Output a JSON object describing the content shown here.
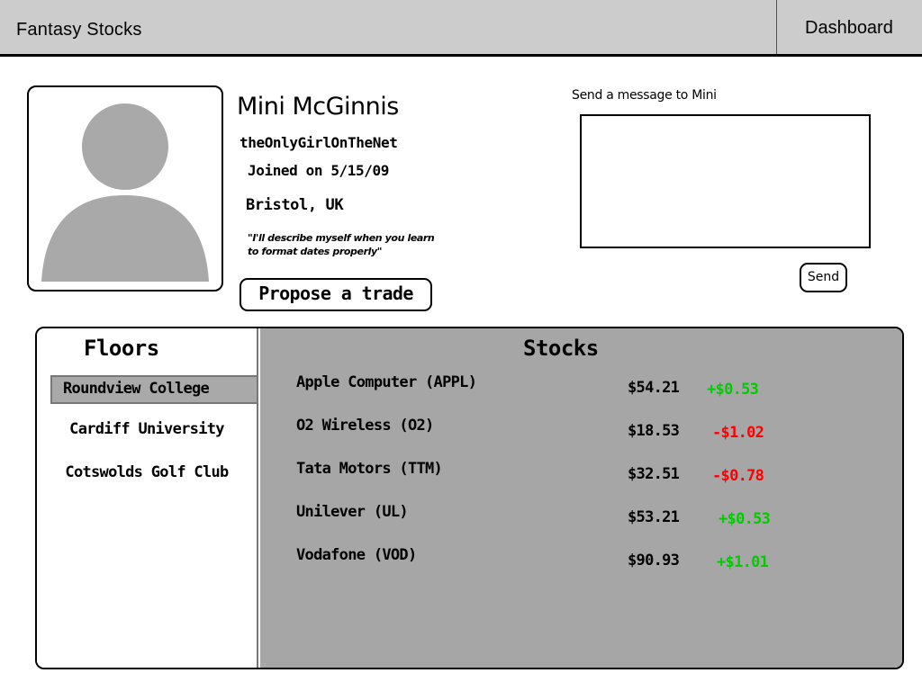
{
  "header": {
    "app_title": "Fantasy Stocks",
    "dashboard_label": "Dashboard"
  },
  "profile": {
    "avatar_icon": "user-silhouette-icon",
    "name": "Mini McGinnis",
    "username": "theOnlyGirlOnTheNet",
    "joined": "Joined on 5/15/09",
    "location": "Bristol, UK",
    "bio_line1": "\"I'll describe myself when you learn",
    "bio_line2": "to format dates properly\"",
    "trade_button_label": "Propose a trade"
  },
  "message": {
    "label": "Send a message to Mini",
    "value": "",
    "send_label": "Send"
  },
  "floors": {
    "title": "Floors",
    "items": [
      {
        "label": "Roundview College",
        "selected": true
      },
      {
        "label": "Cardiff University",
        "selected": false
      },
      {
        "label": "Cotswolds Golf Club",
        "selected": false
      }
    ]
  },
  "stocks": {
    "title": "Stocks",
    "positive_color": "#00cc00",
    "negative_color": "#ff0000",
    "items": [
      {
        "name": "Apple Computer (APPL)",
        "price": "$54.21",
        "change": "+$0.53",
        "direction": "up"
      },
      {
        "name": "O2 Wireless (O2)",
        "price": "$18.53",
        "change": "-$1.02",
        "direction": "down"
      },
      {
        "name": "Tata Motors (TTM)",
        "price": "$32.51",
        "change": "-$0.78",
        "direction": "down"
      },
      {
        "name": "Unilever (UL)",
        "price": "$53.21",
        "change": "+$0.53",
        "direction": "up"
      },
      {
        "name": "Vodafone (VOD)",
        "price": "$90.93",
        "change": "+$1.01",
        "direction": "up"
      }
    ]
  }
}
